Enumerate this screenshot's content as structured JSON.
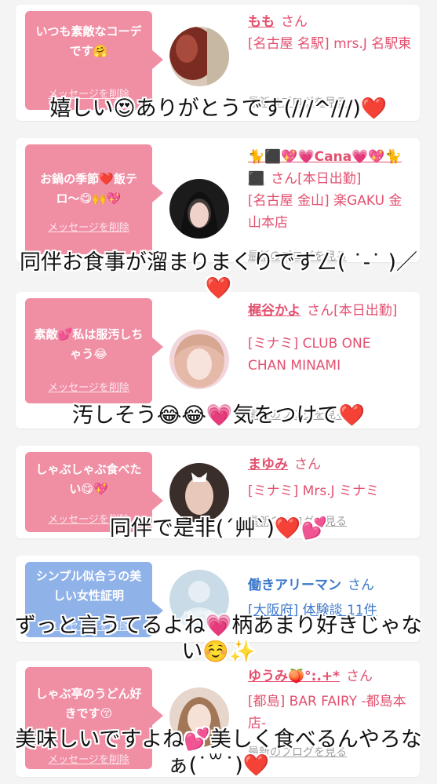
{
  "cards": [
    {
      "bubble": "いつも素敵なコーデです🤗",
      "delete": "メッセージを削除",
      "name": "もも",
      "san": "さん",
      "shop": "[名古屋 名駅] mrs.J 名駅東",
      "blog": "最新のブログを見る"
    },
    {
      "bubble": "お鍋の季節❤️飯テロ〜😋🙌💖",
      "delete": "メッセージを削除",
      "name": "🐈⬛💖💗Cana💗💖🐈⬛",
      "san": "さん[本日出勤]",
      "shop": "[名古屋 金山] 楽GAKU 金山本店",
      "blog": "最新のブログを見る"
    },
    {
      "bubble": "素敵💕私は服汚しちゃう😂",
      "delete": "メッセージを削除",
      "name": "梶谷かよ",
      "san": "さん[本日出勤]",
      "shop": "[ミナミ] CLUB ONE CHAN MINAMI",
      "blog": "最新のブログを見る"
    },
    {
      "bubble": "しゃぶしゃぶ食べたい😋💖",
      "delete": "メッセージを削除",
      "name": "まゆみ",
      "san": "さん",
      "shop": "[ミナミ] Mrs.J ミナミ",
      "blog": "最新のブログを見る"
    },
    {
      "bubble": "シンプル似合うの美しい女性証明",
      "delete": "メッセージを削除",
      "name": "働きアリーマン",
      "san": "さん",
      "shop": "[大阪府] 体験談 11件",
      "avatar_text": "no photo",
      "blog": ""
    },
    {
      "bubble": "しゃぶ亭のうどん好きです😚",
      "delete": "メッセージを削除",
      "name": "ゆうみ🍑°:.+*",
      "san": "さん",
      "shop": "[都島] BAR FAIRY -都島本店-",
      "blog": "最新のブログを見る"
    }
  ],
  "captions": [
    "嬉しい😍ありがとうです(///^///)❤️",
    "同伴お食事が溜まりまくりですㄥ( ˙-˙ )／❤️",
    "汚しそう😂😂💗気をつけて❤️",
    "同伴で是非(´艸`)❤️💕",
    "ずっと言うてるよね💗柄あまり好きじゃない☺️✨",
    "美味しいですよね💕美しく食べるんやろなぁ(˙꒳˙)❤️"
  ],
  "colors": {
    "bubble_pink": "#f08ea4",
    "bubble_blue": "#8fb2e9",
    "name_pink": "#e3506f",
    "name_blue": "#3c78c9",
    "caption_heart": "#e11a2a"
  }
}
